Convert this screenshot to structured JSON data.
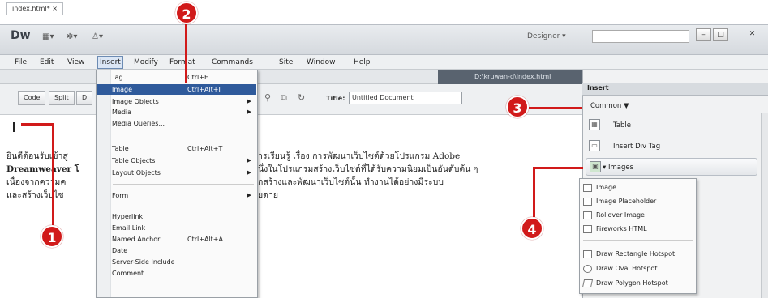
{
  "app": {
    "logo": "Dw",
    "workspace": "Designer",
    "window_buttons": [
      "–",
      "□",
      "✕"
    ]
  },
  "menubar": [
    "File",
    "Edit",
    "View",
    "Insert",
    "Modify",
    "Format",
    "Commands",
    "Site",
    "Window",
    "Help"
  ],
  "document": {
    "tab": "index.html*",
    "close": "×",
    "path": "D:\\kruwan-d\\index.html",
    "view_buttons": [
      "Code",
      "Split",
      "D"
    ],
    "title_label": "Title:",
    "title_value": "Untitled Document",
    "paragraph_lines": [
      "ยินดีต้อนรับเข้าสู่",
      "Dreamweaver โ",
      "เนื่องจากความค",
      "และสร้างเว็บไซ"
    ],
    "paragraph_right": [
      "ารเรียนรู้ เรื่อง การพัฒนาเว็บไซต์ด้วยโปรแกรม Adobe",
      "นึ่งในโปรแกรมสร้างเว็บไซต์ที่ได้รับความนิยมเป็นอันดับต้น ๆ",
      "กสร้างและพัฒนาเว็บไซต์นั้น ทำงานได้อย่างมีระบบ",
      "ยดาย"
    ]
  },
  "insert_menu": {
    "items": [
      {
        "label": "Tag...",
        "shortcut": "Ctrl+E",
        "submenu": false
      },
      {
        "label": "Image",
        "shortcut": "Ctrl+Alt+I",
        "submenu": false,
        "highlighted": true
      },
      {
        "label": "Image Objects",
        "shortcut": "",
        "submenu": true
      },
      {
        "label": "Media",
        "shortcut": "",
        "submenu": true
      },
      {
        "label": "Media Queries...",
        "shortcut": "",
        "submenu": false
      },
      {
        "label": "Table",
        "shortcut": "Ctrl+Alt+T",
        "submenu": false
      },
      {
        "label": "Table Objects",
        "shortcut": "",
        "submenu": true
      },
      {
        "label": "Layout Objects",
        "shortcut": "",
        "submenu": true
      },
      {
        "label": "Form",
        "shortcut": "",
        "submenu": true
      },
      {
        "label": "Hyperlink",
        "shortcut": "",
        "submenu": false
      },
      {
        "label": "Email Link",
        "shortcut": "",
        "submenu": false
      },
      {
        "label": "Named Anchor",
        "shortcut": "Ctrl+Alt+A",
        "submenu": false
      },
      {
        "label": "Date",
        "shortcut": "",
        "submenu": false
      },
      {
        "label": "Server-Side Include",
        "shortcut": "",
        "submenu": false
      },
      {
        "label": "Comment",
        "shortcut": "",
        "submenu": false
      }
    ]
  },
  "insert_panel": {
    "tab": "Insert",
    "category": "Common",
    "items": [
      "Table",
      "Insert Div Tag",
      "Images"
    ]
  },
  "images_flyout": {
    "group1": [
      "Image",
      "Image Placeholder",
      "Rollover Image",
      "Fireworks HTML"
    ],
    "group2": [
      "Draw Rectangle Hotspot",
      "Draw Oval Hotspot",
      "Draw Polygon Hotspot"
    ]
  },
  "callouts": [
    "1",
    "2",
    "3",
    "4"
  ],
  "accent_color": "#d11a1a"
}
